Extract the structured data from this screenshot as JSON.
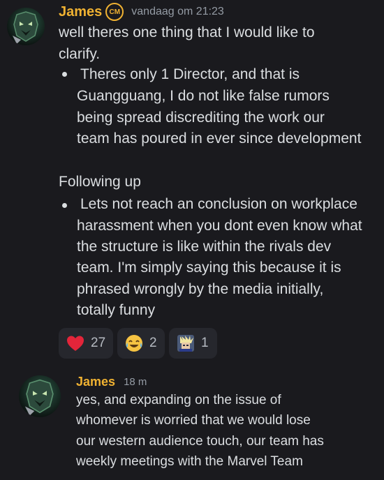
{
  "messages": [
    {
      "author": "James",
      "badge": "CM",
      "timestamp": "vandaag om 21:23",
      "lines": [
        "well theres one thing that I would like to",
        "clarify.",
        "Theres only 1 Director, and that is",
        "Guangguang, I do not like false rumors",
        "being spread discrediting the work our",
        "team has poured in ever since development",
        "Following up",
        "Lets not reach an conclusion on workplace",
        "harassment when you dont even know what",
        "the structure is like within the rivals dev",
        "team. I'm simply saying this because it is",
        "phrased wrongly by the media initially,",
        "totally funny"
      ],
      "reactions": [
        {
          "emoji": "heart-emoji",
          "count": "27"
        },
        {
          "emoji": "joy-emoji",
          "count": "2"
        },
        {
          "emoji": "custom-character-emoji",
          "count": "1"
        }
      ]
    },
    {
      "author": "James",
      "timestamp": "18 m",
      "lines": [
        "yes, and expanding on the issue of",
        "whomever is worried that we would lose",
        "our western audience touch, our team has",
        "weekly meetings with the Marvel Team"
      ]
    }
  ],
  "colors": {
    "background": "#1a1a1e",
    "username": "#f0b232",
    "text": "#dbdee1",
    "timestamp": "#949ba4",
    "reaction_bg": "#26272d"
  }
}
